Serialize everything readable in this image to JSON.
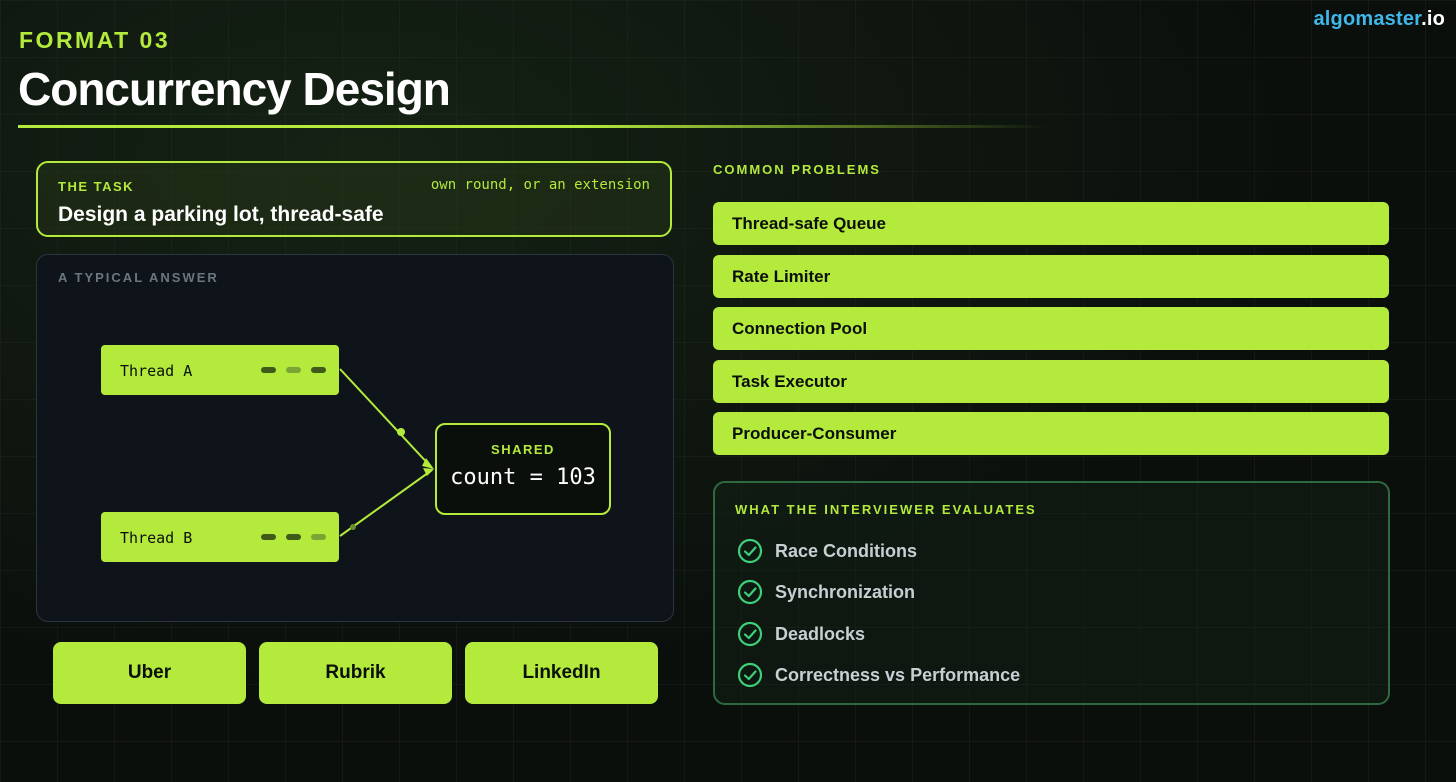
{
  "brand": {
    "part1": "algomaster",
    "part2": ".io"
  },
  "header": {
    "kicker": "FORMAT 03",
    "title": "Concurrency Design"
  },
  "task": {
    "label": "THE TASK",
    "note": "own round, or an extension",
    "title": "Design a parking lot, thread-safe"
  },
  "answer": {
    "label": "A TYPICAL ANSWER",
    "threads": [
      {
        "name": "Thread A"
      },
      {
        "name": "Thread B"
      }
    ],
    "shared": {
      "label": "SHARED",
      "value": "count = 103"
    }
  },
  "companies": [
    "Uber",
    "Rubrik",
    "LinkedIn"
  ],
  "problems": {
    "label": "COMMON PROBLEMS",
    "items": [
      "Thread-safe Queue",
      "Rate Limiter",
      "Connection Pool",
      "Task Executor",
      "Producer-Consumer"
    ]
  },
  "evaluates": {
    "label": "WHAT THE INTERVIEWER EVALUATES",
    "icon": "check-circle-icon",
    "items": [
      "Race Conditions",
      "Synchronization",
      "Deadlocks",
      "Correctness vs Performance"
    ]
  },
  "colors": {
    "accent": "#b3ea3c",
    "background": "#0b0f0c",
    "brand_blue": "#3fb6e8",
    "eval_border": "#2e6a40"
  }
}
